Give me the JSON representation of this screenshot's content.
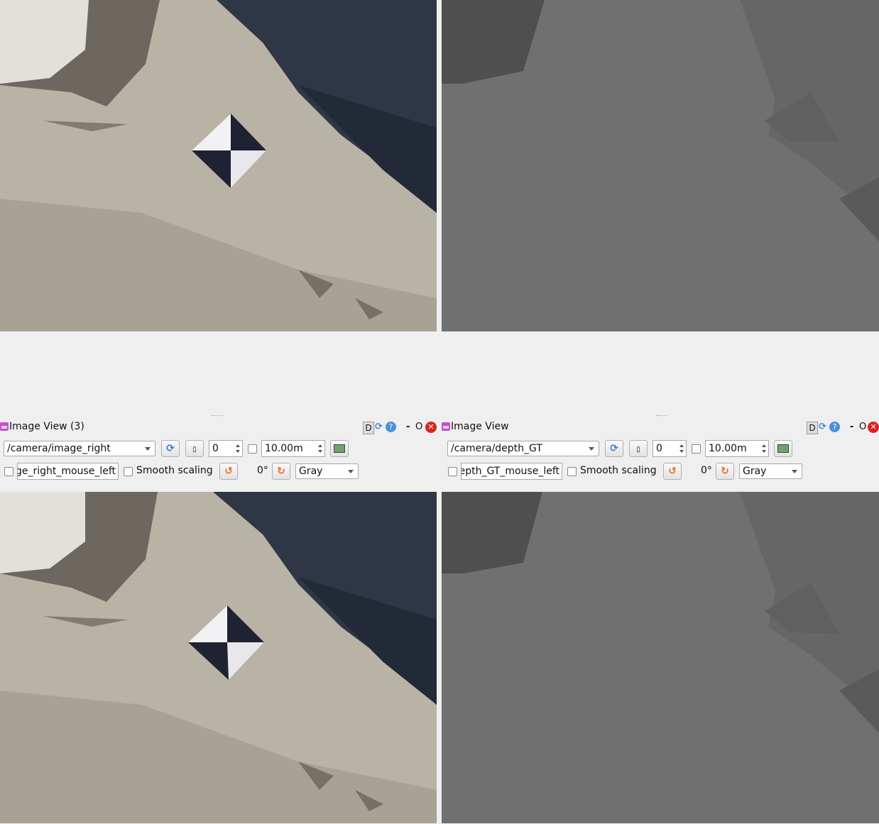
{
  "left": {
    "title": "Image View (3)",
    "topic": "/camera/image_right",
    "spin_value": "0",
    "max_range": "10.00m",
    "mouse_topic": "ge_right_mouse_left",
    "smooth_label": "Smooth scaling",
    "rotation": "0°",
    "colormap": "Gray"
  },
  "right": {
    "title": "Image View",
    "topic": "/camera/depth_GT",
    "spin_value": "0",
    "max_range": "10.00m",
    "mouse_topic": "epth_GT_mouse_left",
    "smooth_label": "Smooth scaling",
    "rotation": "0°",
    "colormap": "Gray"
  },
  "titlebar_buttons": {
    "d": "D",
    "help": "?",
    "dash": "-",
    "o": "O",
    "close": "✕"
  },
  "icons": [
    "window-icon",
    "reload-icon",
    "help-icon",
    "close-icon",
    "refresh-icon",
    "zoom-icon",
    "save-icon",
    "rotate-left-icon",
    "rotate-right-icon"
  ]
}
